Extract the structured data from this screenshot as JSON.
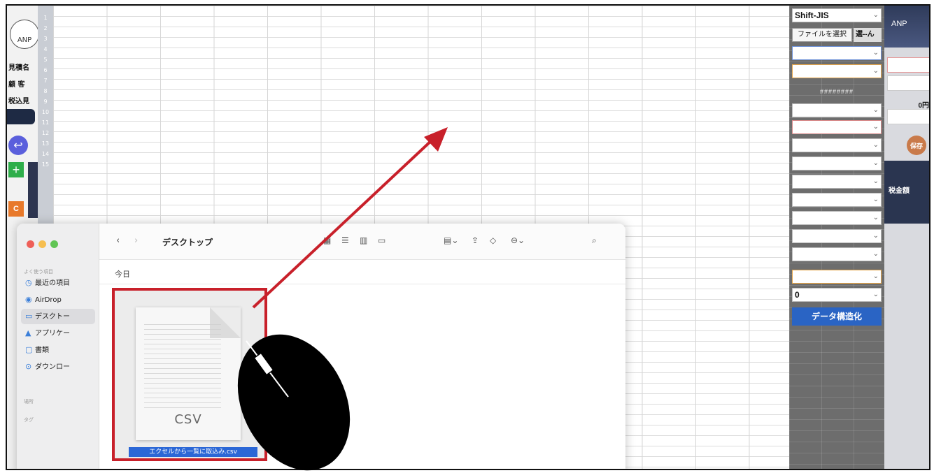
{
  "left_app": {
    "logo_text": "ANP",
    "labels": [
      "見積名",
      "顧 客",
      "税込見"
    ],
    "c_button": "C"
  },
  "row_numbers": [
    "1",
    "2",
    "3",
    "4",
    "5",
    "6",
    "7",
    "8",
    "9",
    "10",
    "11",
    "12",
    "13",
    "14",
    "15"
  ],
  "right_panel": {
    "encoding_select": "Shift-JIS",
    "file_button": "ファイルを選択",
    "file_label": "選--ん",
    "header_text": "########",
    "number_select": "0",
    "structure_button": "データ構造化"
  },
  "far_right": {
    "brand": "ANP",
    "zero_label": "0円",
    "save_label": "保存",
    "band_label": "税金額"
  },
  "finder": {
    "title": "デスクトップ",
    "today_label": "今日",
    "sidebar_sections": [
      "よく使う項目",
      "場所",
      "タグ"
    ],
    "sidebar_items": [
      {
        "icon": "clock-icon",
        "glyph": "◷",
        "label": "最近の項目"
      },
      {
        "icon": "airdrop-icon",
        "glyph": "◉",
        "label": "AirDrop"
      },
      {
        "icon": "desktop-icon",
        "glyph": "▭",
        "label": "デスクトー"
      },
      {
        "icon": "apps-icon",
        "glyph": "▲",
        "label": "アプリケー"
      },
      {
        "icon": "document-icon",
        "glyph": "▢",
        "label": "書類"
      },
      {
        "icon": "download-icon",
        "glyph": "⊙",
        "label": "ダウンロー"
      }
    ],
    "file": {
      "type_label": "CSV",
      "name": "エクセルから一覧に取込み.csv"
    }
  },
  "annotation": {
    "highlight_color": "#c8202a",
    "arrow_color": "#c8202a"
  }
}
